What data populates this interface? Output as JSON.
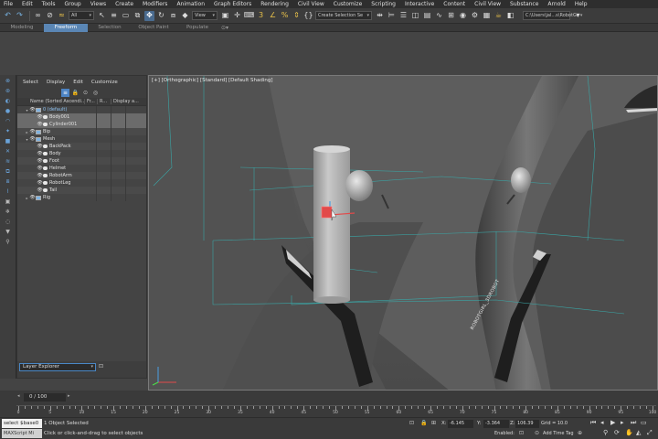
{
  "menu": [
    "File",
    "Edit",
    "Tools",
    "Group",
    "Views",
    "Create",
    "Modifiers",
    "Animation",
    "Graph Editors",
    "Rendering",
    "Civil View",
    "Customize",
    "Scripting",
    "Interactive",
    "Content",
    "Civil View",
    "Substance",
    "Arnold",
    "Help"
  ],
  "toolbar": {
    "filter_dropdown": "All",
    "view_dropdown": "View",
    "selection_set_placeholder": "Create Selection Se",
    "path_dropdown": "C:\\Users\\jal...s\\RobotGr"
  },
  "ribbon": {
    "tabs": [
      "Modeling",
      "Freeform",
      "Selection",
      "Object Paint",
      "Populate"
    ],
    "active_tab": "Freeform",
    "extra_icon": "view-options-icon"
  },
  "explorer": {
    "menu": [
      "Select",
      "Display",
      "Edit",
      "Customize"
    ],
    "header": {
      "name": "Name (Sorted Ascendi...",
      "frozen": "Fr...",
      "renderable": "R...",
      "display": "Display a..."
    },
    "rows": [
      {
        "label": "0 (default)",
        "depth": 0,
        "kind": "layer",
        "expanded": true
      },
      {
        "label": "Body001",
        "depth": 1,
        "kind": "object",
        "selected": true
      },
      {
        "label": "Cylinder001",
        "depth": 1,
        "kind": "object",
        "selected": true
      },
      {
        "label": "Bip",
        "depth": 0,
        "kind": "layer",
        "expanded": false
      },
      {
        "label": "Mesh",
        "depth": 0,
        "kind": "layer",
        "expanded": true
      },
      {
        "label": "BackPack",
        "depth": 1,
        "kind": "object"
      },
      {
        "label": "Body",
        "depth": 1,
        "kind": "object"
      },
      {
        "label": "Foot",
        "depth": 1,
        "kind": "object"
      },
      {
        "label": "Helmet",
        "depth": 1,
        "kind": "object"
      },
      {
        "label": "RobotArm",
        "depth": 1,
        "kind": "object"
      },
      {
        "label": "RobotLeg",
        "depth": 1,
        "kind": "object"
      },
      {
        "label": "Tail",
        "depth": 1,
        "kind": "object"
      },
      {
        "label": "Rig",
        "depth": 0,
        "kind": "layer",
        "expanded": false
      }
    ],
    "layer_explorer": "Layer Explorer"
  },
  "viewport": {
    "label": "[+] [Orthographic] [Standard] [Default Shading]",
    "surface_text": "ROBOTGIRL_3DROBOT"
  },
  "timeslider": {
    "frame": "0 / 100",
    "ticks": [
      0,
      5,
      10,
      15,
      20,
      25,
      30,
      35,
      40,
      45,
      50,
      55,
      60,
      65,
      70,
      75,
      80,
      85,
      90,
      95,
      100
    ]
  },
  "status": {
    "script_input": "select $base0",
    "script_label": "MAXScript Mi",
    "selected": "1 Object Selected",
    "prompt": "Click or click-and-drag to select objects",
    "x_label": "X:",
    "x_value": "-6.145",
    "y_label": "Y:",
    "y_value": "-3.364",
    "z_label": "Z:",
    "z_value": "106.39",
    "grid": "Grid = 10.0",
    "enabled_label": "Enabled:",
    "add_time_tag": "Add Time Tag"
  },
  "colors": {
    "selection_highlight": "#6b6b6b",
    "accent_blue": "#5a86b5",
    "gizmo_red": "#e24a4a"
  }
}
